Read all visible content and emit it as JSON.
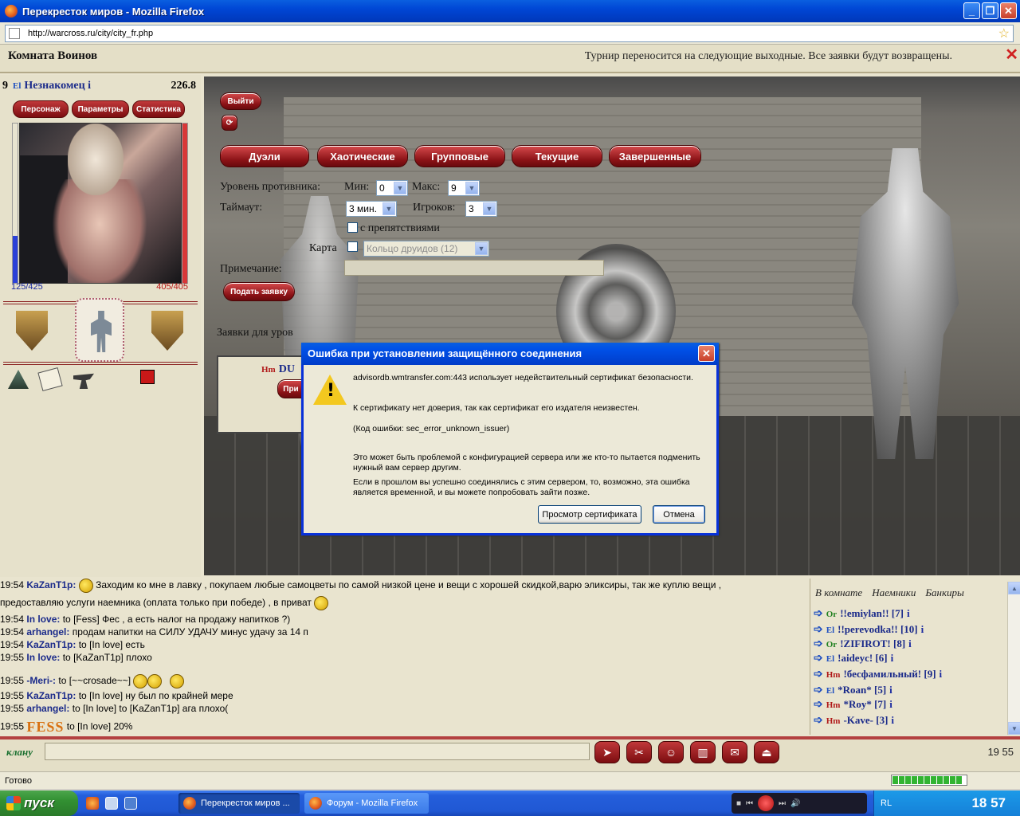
{
  "window": {
    "title": "Перекресток миров - Mozilla Firefox",
    "url": "http://warcross.ru/city/city_fr.php"
  },
  "top": {
    "room": "Комната Воинов",
    "announcement": "Турнир переносится на следующие выходные. Все заявки будут возвращены.",
    "close": "✕"
  },
  "character": {
    "level": "9",
    "clan_tag": "El",
    "name": "Незнакомец",
    "info": "i",
    "weight": "226.8",
    "tabs": [
      "Персонаж",
      "Параметры",
      "Статистика"
    ],
    "hp": "125/425",
    "hp_fraction": 0.294,
    "mp": "405/405"
  },
  "arena": {
    "exit_label": "Выйти",
    "refresh_icon": "refresh-icon",
    "tabs": [
      "Дуэли",
      "Хаотические",
      "Групповые",
      "Текущие",
      "Завершенные"
    ],
    "level_label": "Уровень противника:",
    "min_label": "Мин:",
    "min_value": "0",
    "max_label": "Макс:",
    "max_value": "9",
    "timeout_label": "Таймаут:",
    "timeout_value": "3 мин.",
    "players_label": "Игроков:",
    "players_value": "3",
    "obstacles_label": "с препятствиями",
    "map_label": "Карта",
    "map_value": "Кольцо друидов (12)",
    "note_label": "Примечание:",
    "submit_label": "Подать заявку",
    "bids_label": "Заявки для уров",
    "bid_tag": "Hm",
    "bid_name": "DU",
    "bid_button": "При"
  },
  "dialog": {
    "title": "Ошибка при установлении защищённого соединения",
    "line1": "advisordb.wmtransfer.com:443 использует недействительный сертификат безопасности.",
    "line2": "К сертификату нет доверия, так как сертификат его издателя неизвестен.",
    "line3": "(Код ошибки: sec_error_unknown_issuer)",
    "line4": "Это может быть проблемой с конфигурацией сервера или же кто-то пытается подменить нужный вам сервер другим.",
    "line5": "Если в прошлом вы успешно соединялись с этим сервером, то, возможно, эта ошибка является временной, и вы можете попробовать зайти позже.",
    "view_cert": "Просмотр сертификата",
    "cancel": "Отмена"
  },
  "chat": [
    {
      "time": "19:54",
      "nick": "KaZanT1p:",
      "text": " Заходим ко мне в лавку , покупаем любые самоцветы по самой низкой цене и вещи с хорошей скидкой,варю эликсиры, так же куплю вещи ,"
    },
    {
      "time": "",
      "nick": "",
      "text": "предоставляю услуги наемника (оплата только при победе) , в приват"
    },
    {
      "time": "19:54",
      "nick": "In love:",
      "text": " to [Fess] Фес , а есть налог на продажу напитков ?)"
    },
    {
      "time": "19:54",
      "nick": "arhangel:",
      "text": " продам напитки на СИЛУ УДАЧУ минус удачу за 14 п"
    },
    {
      "time": "19:54",
      "nick": "KaZanT1p:",
      "text": " to [In love] есть"
    },
    {
      "time": "19:55",
      "nick": "In love:",
      "text": " to [KaZanT1p] плохо"
    },
    {
      "time": "19:55",
      "nick": "-Meri-:",
      "text": " to [~~crosade~~]"
    },
    {
      "time": "19:55",
      "nick": "KaZanT1p:",
      "text": " to [In love] ну был по крайней мере"
    },
    {
      "time": "19:55",
      "nick": "arhangel:",
      "text": " to [In love] to [KaZanT1p] ага плохо("
    },
    {
      "time": "19:55",
      "nick": "FESS",
      "text": " to [In love] 20%"
    }
  ],
  "room_list": {
    "tabs": [
      "В комнате",
      "Наемники",
      "Банкиры"
    ],
    "users": [
      {
        "tag": "Or",
        "name": "!!emiylan!! [7]",
        "info": "i"
      },
      {
        "tag": "El",
        "name": "!!perevodka!! [10]",
        "info": "i"
      },
      {
        "tag": "Or",
        "name": "!ZIFIROT! [8]",
        "info": "i"
      },
      {
        "tag": "El",
        "name": "!aideyc! [6]",
        "info": "i"
      },
      {
        "tag": "Hm",
        "name": "!бесфамильный! [9]",
        "info": "i"
      },
      {
        "tag": "El",
        "name": "*Roan* [5]",
        "info": "i"
      },
      {
        "tag": "Hm",
        "name": "*Roy* [7]",
        "info": "i"
      },
      {
        "tag": "Hm",
        "name": "-Kave- [3]",
        "info": "i"
      }
    ]
  },
  "bottom": {
    "clan_label": "клану",
    "clock": "19 55"
  },
  "status": {
    "text": "Готово"
  },
  "taskbar": {
    "start": "пуск",
    "task1": "Перекресток миров ...",
    "task2": "Форум - Mozilla Firefox",
    "lang": "RL",
    "time": "18 57"
  }
}
